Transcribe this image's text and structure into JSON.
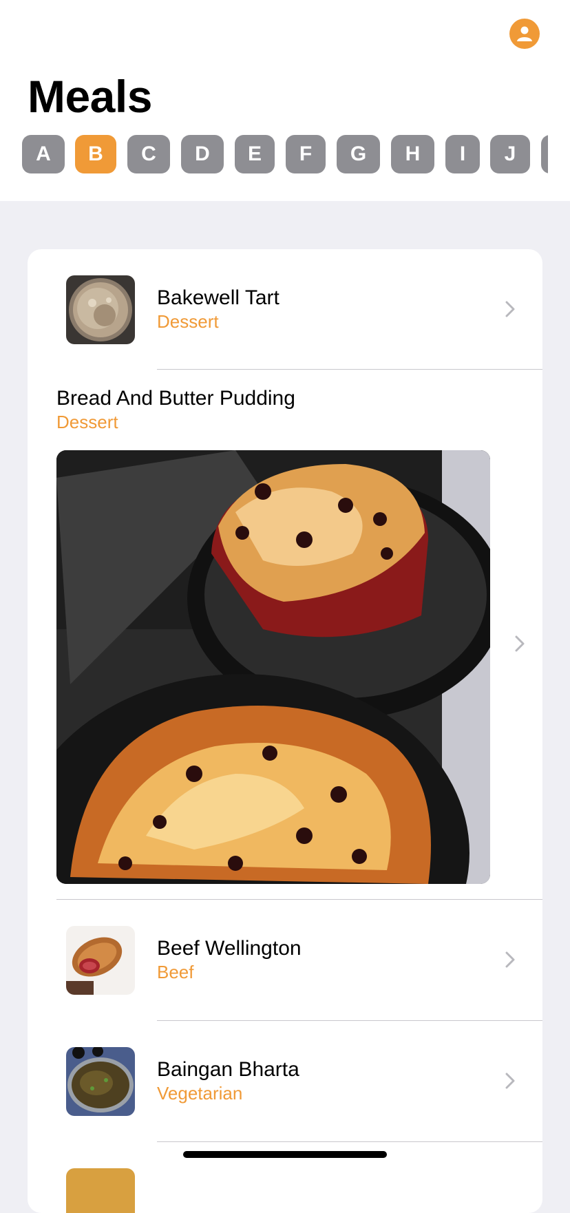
{
  "header": {
    "title": "Meals",
    "profile_icon": "person-circle-icon",
    "accent_color": "#f09a37"
  },
  "letters": {
    "items": [
      "A",
      "B",
      "C",
      "D",
      "E",
      "F",
      "G",
      "H",
      "I",
      "J",
      ""
    ],
    "selected": "B"
  },
  "meals": [
    {
      "name": "Bakewell Tart",
      "category": "Dessert"
    },
    {
      "name": "Bread And Butter Pudding",
      "category": "Dessert"
    },
    {
      "name": "Beef Wellington",
      "category": "Beef"
    },
    {
      "name": "Baingan Bharta",
      "category": "Vegetarian"
    }
  ]
}
